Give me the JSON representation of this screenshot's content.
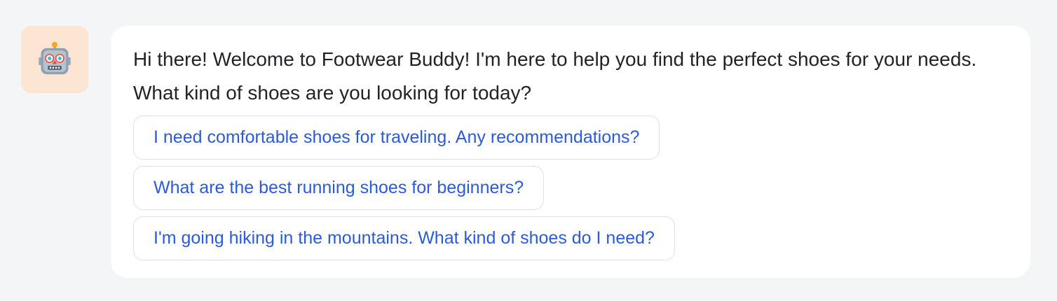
{
  "chat": {
    "avatar_icon": "robot-face-icon",
    "colors": {
      "page_background": "#f4f5f7",
      "avatar_background": "#fde5d3",
      "bubble_background": "#ffffff",
      "suggestion_text": "#2b5bd7",
      "message_text": "#1f2328"
    },
    "message": "Hi there! Welcome to Footwear Buddy! I'm here to help you find the perfect shoes for your needs. What kind of shoes are you looking for today?",
    "suggestions": [
      {
        "label": "I need comfortable shoes for traveling. Any recommendations?"
      },
      {
        "label": "What are the best running shoes for beginners?"
      },
      {
        "label": "I'm going hiking in the mountains. What kind of shoes do I need?"
      }
    ]
  }
}
